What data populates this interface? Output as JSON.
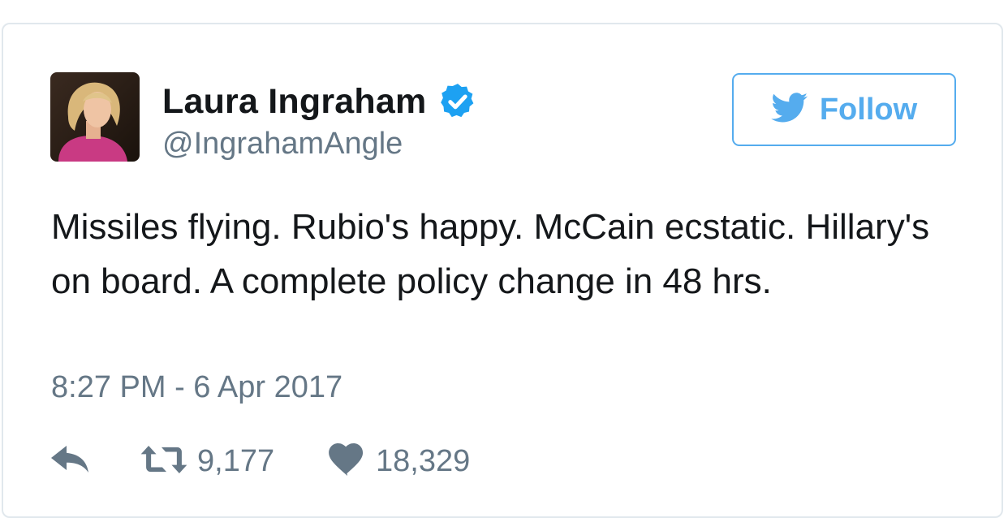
{
  "author": {
    "name": "Laura Ingraham",
    "handle": "@IngrahamAngle",
    "verified": true
  },
  "follow_button": {
    "label": "Follow"
  },
  "tweet": {
    "text": "Missiles flying. Rubio's happy. McCain ecstatic. Hillary's on board. A complete policy change in 48 hrs.",
    "timestamp": "8:27 PM - 6 Apr 2017"
  },
  "actions": {
    "retweets": "9,177",
    "likes": "18,329"
  },
  "icons": {
    "verified": "verified-badge-icon",
    "follow": "twitter-bird-icon",
    "reply": "reply-icon",
    "retweet": "retweet-icon",
    "like": "heart-icon"
  },
  "colors": {
    "accent": "#55acee",
    "verified": "#1da1f2",
    "text_primary": "#14171a",
    "text_secondary": "#657786",
    "border": "#e1e8ed"
  }
}
